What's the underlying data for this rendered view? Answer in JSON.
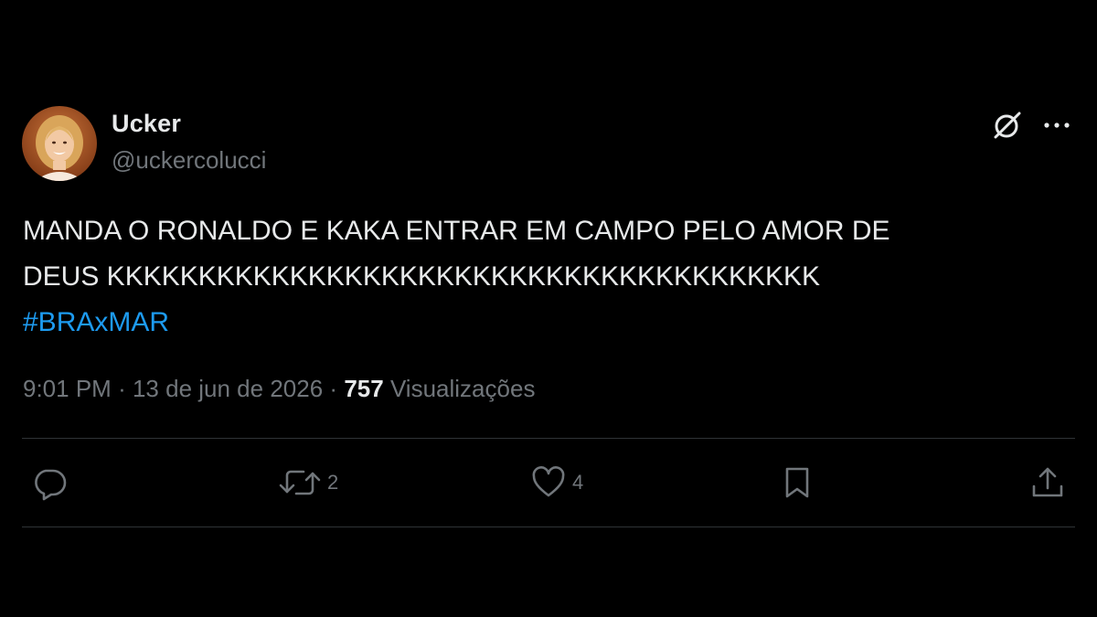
{
  "author": {
    "display_name": "Ucker",
    "handle": "@uckercolucci"
  },
  "icons": {
    "grok": "grok-icon",
    "more": "more-horizontal-icon"
  },
  "tweet": {
    "text": "MANDA O RONALDO E KAKA ENTRAR EM CAMPO PELO AMOR DE\nDEUS KKKKKKKKKKKKKKKKKKKKKKKKKKKKKKKKKKKKKKK",
    "hashtag": "#BRAxMAR"
  },
  "meta": {
    "time": "9:01 PM",
    "separator": "·",
    "date": "13 de jun de 2026",
    "views_count": "757",
    "views_label": "Visualizações"
  },
  "actions": {
    "reply_count": "",
    "retweet_count": "2",
    "like_count": "4"
  },
  "colors": {
    "background": "#000000",
    "text": "#e7e9ea",
    "secondary": "#71767b",
    "link": "#1d9bf0",
    "divider": "#2f3336"
  }
}
